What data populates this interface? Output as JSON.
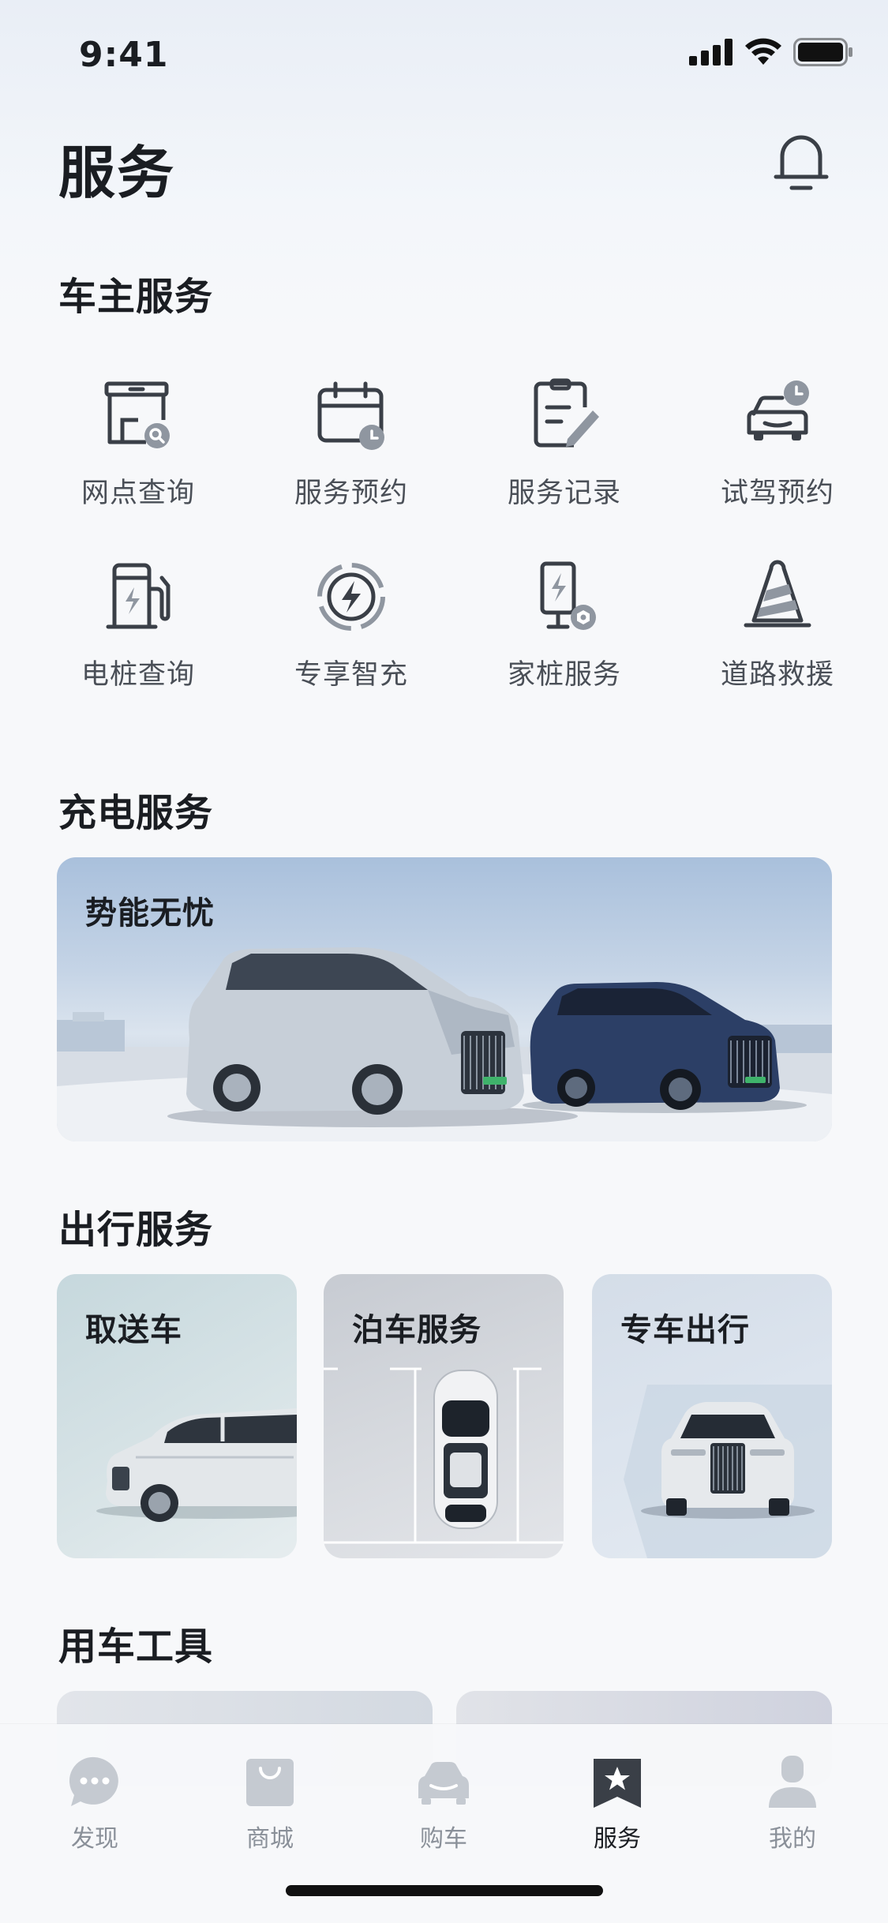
{
  "status_bar": {
    "time": "9:41"
  },
  "header": {
    "title": "服务"
  },
  "owner_services": {
    "title": "车主服务",
    "items": [
      {
        "label": "网点查询",
        "icon": "store-search-icon"
      },
      {
        "label": "服务预约",
        "icon": "calendar-clock-icon"
      },
      {
        "label": "服务记录",
        "icon": "edit-document-icon"
      },
      {
        "label": "试驾预约",
        "icon": "car-clock-icon"
      },
      {
        "label": "电桩查询",
        "icon": "charging-pile-icon"
      },
      {
        "label": "专享智充",
        "icon": "lightning-circle-icon"
      },
      {
        "label": "家桩服务",
        "icon": "home-charger-icon"
      },
      {
        "label": "道路救援",
        "icon": "traffic-cone-icon"
      }
    ]
  },
  "charging_services": {
    "title": "充电服务",
    "banner_title": "势能无忧"
  },
  "travel_services": {
    "title": "出行服务",
    "cards": [
      {
        "label": "取送车"
      },
      {
        "label": "泊车服务"
      },
      {
        "label": "专车出行"
      }
    ]
  },
  "car_tools": {
    "title": "用车工具"
  },
  "tabbar": {
    "tabs": [
      {
        "label": "发现",
        "icon": "chat-bubble-icon"
      },
      {
        "label": "商城",
        "icon": "shopping-bag-icon"
      },
      {
        "label": "购车",
        "icon": "car-icon"
      },
      {
        "label": "服务",
        "icon": "star-bookmark-icon",
        "active": true
      },
      {
        "label": "我的",
        "icon": "person-icon"
      }
    ]
  },
  "colors": {
    "accent": "#1a1d22",
    "icon_gray": "#3a3f47",
    "icon_secondary": "#8f96a0",
    "tab_inactive": "#c5cad1"
  }
}
